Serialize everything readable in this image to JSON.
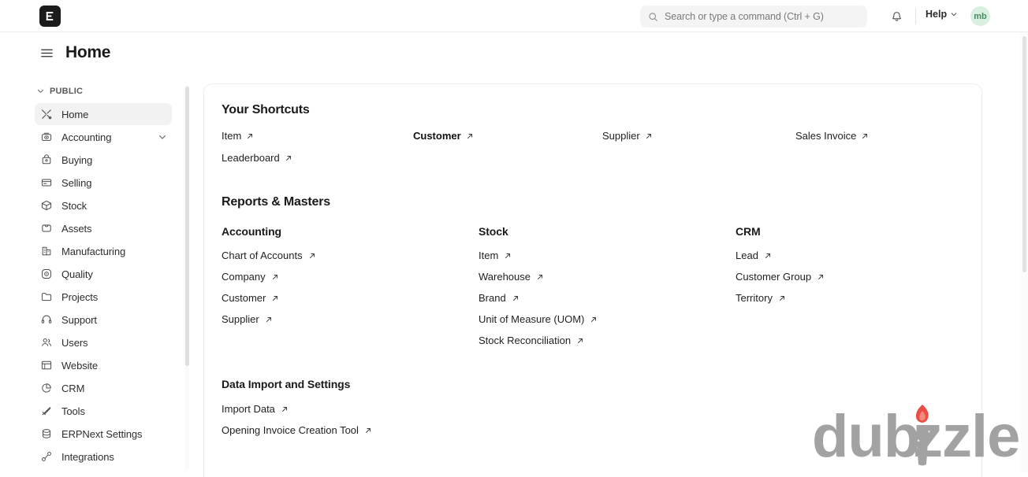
{
  "navbar": {
    "logo_letter": "E",
    "logo_name": "erpnext-logo",
    "search": {
      "placeholder": "Search or type a command (Ctrl + G)",
      "value": ""
    },
    "notifications_icon": "bell-icon",
    "help_label": "Help",
    "avatar_initials": "mb",
    "avatar_bg": "#d9f0e0",
    "avatar_fg": "#4b8a62"
  },
  "header": {
    "menu_icon": "hamburger-icon",
    "title": "Home"
  },
  "sidebar": {
    "section_label": "PUBLIC",
    "items": [
      {
        "label": "Home",
        "icon": "tools-icon",
        "active": true,
        "expandable": false
      },
      {
        "label": "Accounting",
        "icon": "piggy-bank-icon",
        "active": false,
        "expandable": true
      },
      {
        "label": "Buying",
        "icon": "shopping-bag-icon",
        "active": false,
        "expandable": false
      },
      {
        "label": "Selling",
        "icon": "card-icon",
        "active": false,
        "expandable": false
      },
      {
        "label": "Stock",
        "icon": "box-icon",
        "active": false,
        "expandable": false
      },
      {
        "label": "Assets",
        "icon": "briefcase-icon",
        "active": false,
        "expandable": false
      },
      {
        "label": "Manufacturing",
        "icon": "factory-icon",
        "active": false,
        "expandable": false
      },
      {
        "label": "Quality",
        "icon": "target-icon",
        "active": false,
        "expandable": false
      },
      {
        "label": "Projects",
        "icon": "folder-icon",
        "active": false,
        "expandable": false
      },
      {
        "label": "Support",
        "icon": "headset-icon",
        "active": false,
        "expandable": false
      },
      {
        "label": "Users",
        "icon": "users-icon",
        "active": false,
        "expandable": false
      },
      {
        "label": "Website",
        "icon": "browser-window-icon",
        "active": false,
        "expandable": false
      },
      {
        "label": "CRM",
        "icon": "pie-chart-icon",
        "active": false,
        "expandable": false
      },
      {
        "label": "Tools",
        "icon": "wrench-icon",
        "active": false,
        "expandable": false
      },
      {
        "label": "ERPNext Settings",
        "icon": "database-icon",
        "active": false,
        "expandable": false
      },
      {
        "label": "Integrations",
        "icon": "plug-icon",
        "active": false,
        "expandable": false
      }
    ]
  },
  "main": {
    "shortcuts": {
      "title": "Your Shortcuts",
      "items": [
        {
          "label": "Item",
          "bold": false
        },
        {
          "label": "Customer",
          "bold": true
        },
        {
          "label": "Supplier",
          "bold": false
        },
        {
          "label": "Sales Invoice",
          "bold": false
        },
        {
          "label": "Leaderboard",
          "bold": false
        }
      ]
    },
    "reports": {
      "title": "Reports & Masters",
      "columns": [
        {
          "title": "Accounting",
          "links": [
            "Chart of Accounts",
            "Company",
            "Customer",
            "Supplier"
          ]
        },
        {
          "title": "Stock",
          "links": [
            "Item",
            "Warehouse",
            "Brand",
            "Unit of Measure (UOM)",
            "Stock Reconciliation"
          ]
        },
        {
          "title": "CRM",
          "links": [
            "Lead",
            "Customer Group",
            "Territory"
          ]
        }
      ]
    },
    "data_import": {
      "title": "Data Import and Settings",
      "links": [
        "Import Data",
        "Opening Invoice Creation Tool"
      ]
    }
  },
  "watermark": {
    "text": "dubizzle",
    "text_color": "#9e9e9e",
    "flame_color": "#e8453c"
  }
}
